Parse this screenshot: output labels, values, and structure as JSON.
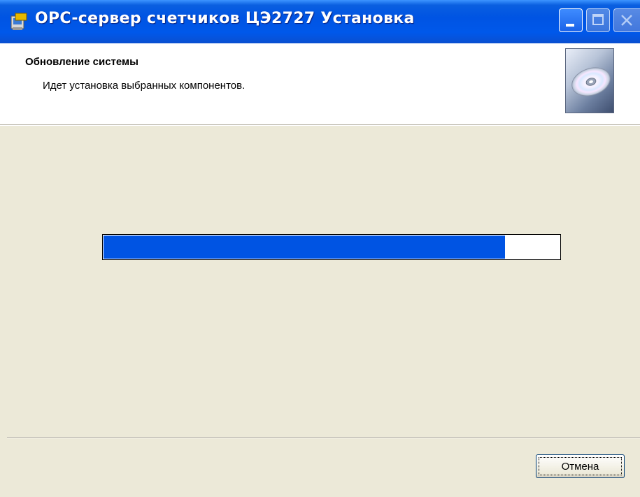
{
  "window": {
    "title": "OPC-сервер счетчиков ЦЭ2727 Установка",
    "icon": "installer-icon",
    "controls": [
      "minimize-icon",
      "maximize-icon",
      "close-icon"
    ]
  },
  "header": {
    "title": "Обновление системы",
    "subtitle": "Идет установка выбранных компонентов.",
    "image": "cd-disc-icon"
  },
  "progress": {
    "percent": 88,
    "color": "#0054e3"
  },
  "buttons": {
    "cancel_label": "Отмена"
  },
  "colors": {
    "titlebar": "#0054e3",
    "dialog_bg": "#ece9d8",
    "header_bg": "#ffffff"
  }
}
